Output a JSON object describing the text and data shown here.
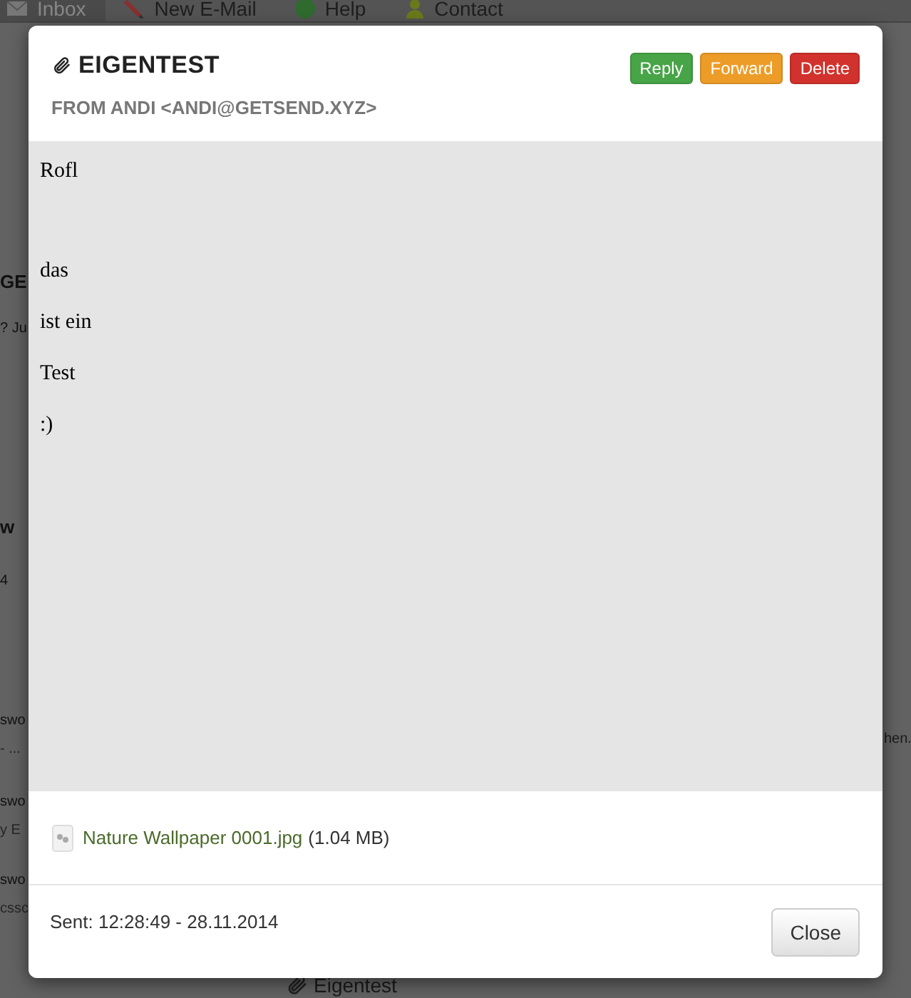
{
  "nav": {
    "items": [
      {
        "label": "Inbox",
        "selected": true
      },
      {
        "label": "New E-Mail",
        "selected": false
      },
      {
        "label": "Help",
        "selected": false
      },
      {
        "label": "Contact",
        "selected": false
      }
    ]
  },
  "background": {
    "left_fragments": [
      {
        "text": "GE",
        "kind": "heading"
      },
      {
        "text": "? Ju",
        "kind": "text"
      },
      {
        "text": "w",
        "kind": "heading"
      },
      {
        "text": "4",
        "kind": "text"
      },
      {
        "text": "swo",
        "kind": "text"
      },
      {
        "text": "- ...",
        "kind": "muted"
      },
      {
        "text": "swo",
        "kind": "text"
      },
      {
        "text": "y E",
        "kind": "muted"
      },
      {
        "text": "swo",
        "kind": "text"
      },
      {
        "text": "cssc",
        "kind": "muted"
      }
    ],
    "right_fragment": "hen.",
    "bottom_item": "Eigentest"
  },
  "modal": {
    "subject": "EIGENTEST",
    "has_attachment": true,
    "from": "FROM ANDI <ANDI@GETSEND.XYZ>",
    "actions": [
      {
        "label": "Reply",
        "color": "#47a447"
      },
      {
        "label": "Forward",
        "color": "#ed9c28"
      },
      {
        "label": "Delete",
        "color": "#d2322d"
      }
    ],
    "body": [
      "Rofl",
      "das",
      "ist ein",
      "Test",
      ":)"
    ],
    "attachment": {
      "name": "Nature Wallpaper 0001.jpg",
      "size": "(1.04 MB)"
    },
    "sent": "Sent: 12:28:49 - 28.11.2014",
    "close": "Close"
  }
}
